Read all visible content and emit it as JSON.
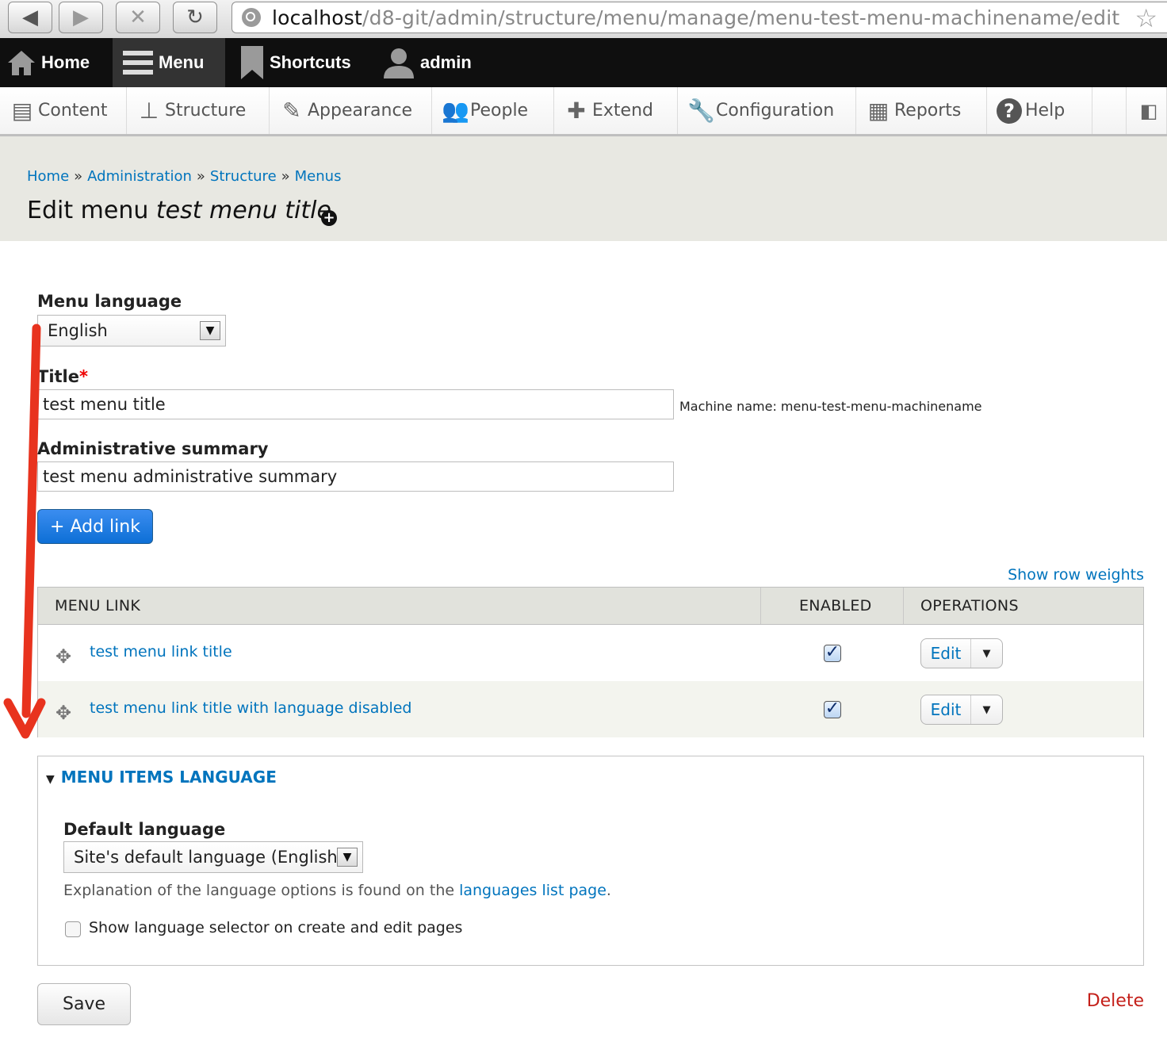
{
  "browser": {
    "url_host": "localhost",
    "url_path": "/d8-git/admin/structure/menu/manage/menu-test-menu-machinename/edit"
  },
  "toolbar": {
    "home": "Home",
    "menu": "Menu",
    "shortcuts": "Shortcuts",
    "user": "admin"
  },
  "admin_menu": {
    "items": [
      "Content",
      "Structure",
      "Appearance",
      "People",
      "Extend",
      "Configuration",
      "Reports",
      "Help"
    ]
  },
  "breadcrumb": [
    "Home",
    "Administration",
    "Structure",
    "Menus"
  ],
  "breadcrumb_separator": "»",
  "page": {
    "title_prefix": "Edit menu",
    "title_name": "test menu title"
  },
  "form": {
    "menu_language_label": "Menu language",
    "menu_language_value": "English",
    "title_label": "Title",
    "required_mark": "*",
    "title_value": "test menu title",
    "machine_name": "Machine name: menu-test-menu-machinename",
    "summary_label": "Administrative summary",
    "summary_value": "test menu administrative summary",
    "add_link": "+ Add link",
    "show_row_weights": "Show row weights"
  },
  "table": {
    "headers": [
      "MENU LINK",
      "ENABLED",
      "OPERATIONS"
    ],
    "rows": [
      {
        "title": "test menu link title",
        "enabled": true,
        "operation": "Edit"
      },
      {
        "title": "test menu link title with language disabled",
        "enabled": true,
        "operation": "Edit"
      }
    ]
  },
  "details": {
    "summary": "MENU ITEMS LANGUAGE",
    "default_language_label": "Default language",
    "default_language_value": "Site's default language (English)",
    "description_prefix": "Explanation of the language options is found on the",
    "description_link": "languages list page",
    "description_suffix": ".",
    "show_selector_label": "Show language selector on create and edit pages"
  },
  "actions": {
    "save": "Save",
    "delete": "Delete"
  },
  "colors": {
    "link": "#0074bd",
    "primary_button": "#0d6fd6",
    "delete": "#c4201a",
    "annotation_arrow": "#e8331e"
  }
}
